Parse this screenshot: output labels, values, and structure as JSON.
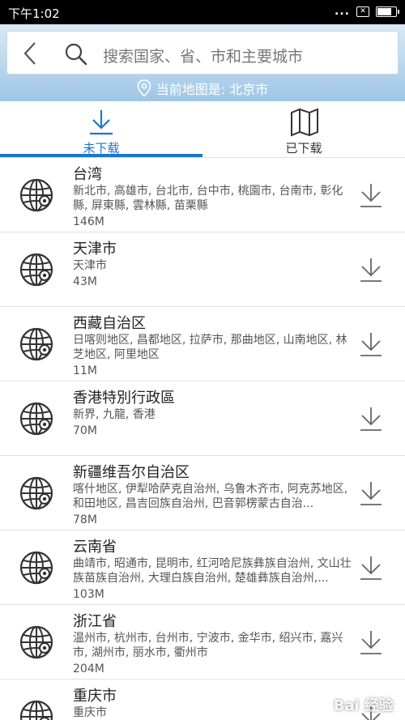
{
  "status_bar": {
    "time": "下午1:02",
    "dots": "...",
    "box_icon_text": "✕",
    "battery_level": 0.85
  },
  "search": {
    "placeholder": "搜索国家、省、市和主要城市"
  },
  "current_map": {
    "text": "当前地图是: 北京市"
  },
  "tabs": [
    {
      "label": "未下载",
      "active": true,
      "icon": "download-icon"
    },
    {
      "label": "已下载",
      "active": false,
      "icon": "map-icon"
    }
  ],
  "colors": {
    "accent": "#1976d2",
    "header_top": "#d9e9f5",
    "header_bottom": "#9fc6e6"
  },
  "regions": [
    {
      "name": "台湾",
      "cities": "新北市, 高雄市, 台北市, 台中市, 桃園市, 台南市, 彰化縣, 屏東縣, 雲林縣, 苗栗縣",
      "size": "146M"
    },
    {
      "name": "天津市",
      "cities": "天津市",
      "size": "43M"
    },
    {
      "name": "西藏自治区",
      "cities": "日喀则地区, 昌都地区, 拉萨市, 那曲地区, 山南地区, 林芝地区, 阿里地区",
      "size": "11M"
    },
    {
      "name": "香港特別行政區",
      "cities": "新界, 九龍, 香港",
      "size": "70M"
    },
    {
      "name": "新疆维吾尔自治区",
      "cities": "喀什地区, 伊犁哈萨克自治州, 乌鲁木齐市, 阿克苏地区, 和田地区, 昌吉回族自治州, 巴音郭楞蒙古自治...",
      "size": "78M"
    },
    {
      "name": "云南省",
      "cities": "曲靖市, 昭通市, 昆明市, 红河哈尼族彝族自治州, 文山壮族苗族自治州, 大理白族自治州, 楚雄彝族自治州,...",
      "size": "103M"
    },
    {
      "name": "浙江省",
      "cities": "温州市, 杭州市, 台州市, 宁波市, 金华市, 绍兴市, 嘉兴市, 湖州市, 丽水市, 衢州市",
      "size": "204M"
    },
    {
      "name": "重庆市",
      "cities": "重庆市",
      "size": ""
    }
  ],
  "watermark": "Bai 经验"
}
